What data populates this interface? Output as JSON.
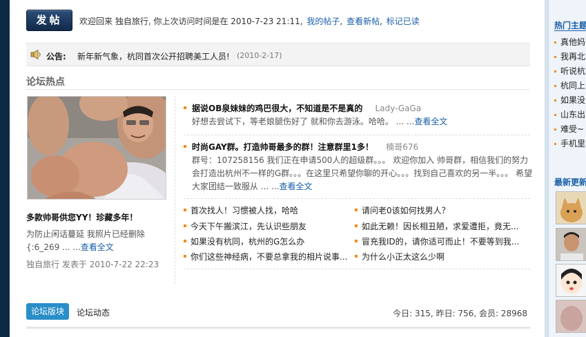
{
  "header": {
    "post_button": "发帖",
    "welcome_prefix": "欢迎回来 独自旅行, 你上次访问时间是在 2010-7-23 21:11,",
    "my_posts": "我的帖子",
    "view_new": "查看新帖",
    "mark_read": "标记已读"
  },
  "notice": {
    "label": "公告:",
    "text": "新年新气象，杭同首次公开招聘美工人员!",
    "date": "(2010-2-17)"
  },
  "section": {
    "title": "论坛热点"
  },
  "featured": {
    "title": "多款帅哥供您YY！珍藏多年！",
    "summary": "为防止闲话蔓延 我照片已经删除 {:6_269 ... ...",
    "read_more": "查看全文",
    "meta": "独自旅行 发表于 2010-7-22 22:23"
  },
  "hot_posts": [
    {
      "title": "据说OB泉妹妹的鸡巴很大，不知道是不是真的",
      "author": "Lady-GaGa",
      "summary": "好想去尝试下，等老娘腿伤好了 就和你去游泳。哈哈。 ... ...",
      "read_more": "查看全文"
    },
    {
      "title": "时尚GAY群。打造帅哥最多的群！注意群里1多！",
      "author": "楠哥676",
      "summary": "群号：107258156 我们正在申请500人的超级群。。。 欢迎你加入 帅哥群，相信我们的努力会打造出杭州不一样的G群。。。在这里只希望你聊的开心。。。找到自己喜欢的另一半。。。 希望大家团结一致服从 ... ...",
      "read_more": "查看全文"
    }
  ],
  "link_list": [
    "首次找人！习惯被人找，哈哈",
    "请问老0该如何找男人？",
    "今天下午搬滨江，先认识些朋友",
    "如此无赖！因长相丑陋，求爱遭拒，竟无...",
    "如果没有杭同，杭州的G怎么办",
    "冒充我ID的，请你适可而止！不要等到我...",
    "你们这些神经病，不要总拿我的相片说事...",
    "为什么小正太这么少啊"
  ],
  "bottom": {
    "tab_blocks": "论坛版块",
    "tab_activity": "论坛动态",
    "stats": "今日: 315, 昨日: 756, 会员: 28968"
  },
  "sidebar": {
    "hot_title": "热门主题",
    "hot_items": [
      "真他妈",
      "我再北",
      "听说杭",
      "杭同上",
      "如果没",
      "山东出",
      "难受~",
      "手机里"
    ],
    "new_title": "最新更新"
  },
  "colors": {
    "accent": "#1a5fa8",
    "bullet": "#f08b1e",
    "tab_active": "#2a8fc8",
    "post_button": "#1c3a60"
  },
  "icons": [
    "speaker-icon",
    "bullet-icon"
  ]
}
